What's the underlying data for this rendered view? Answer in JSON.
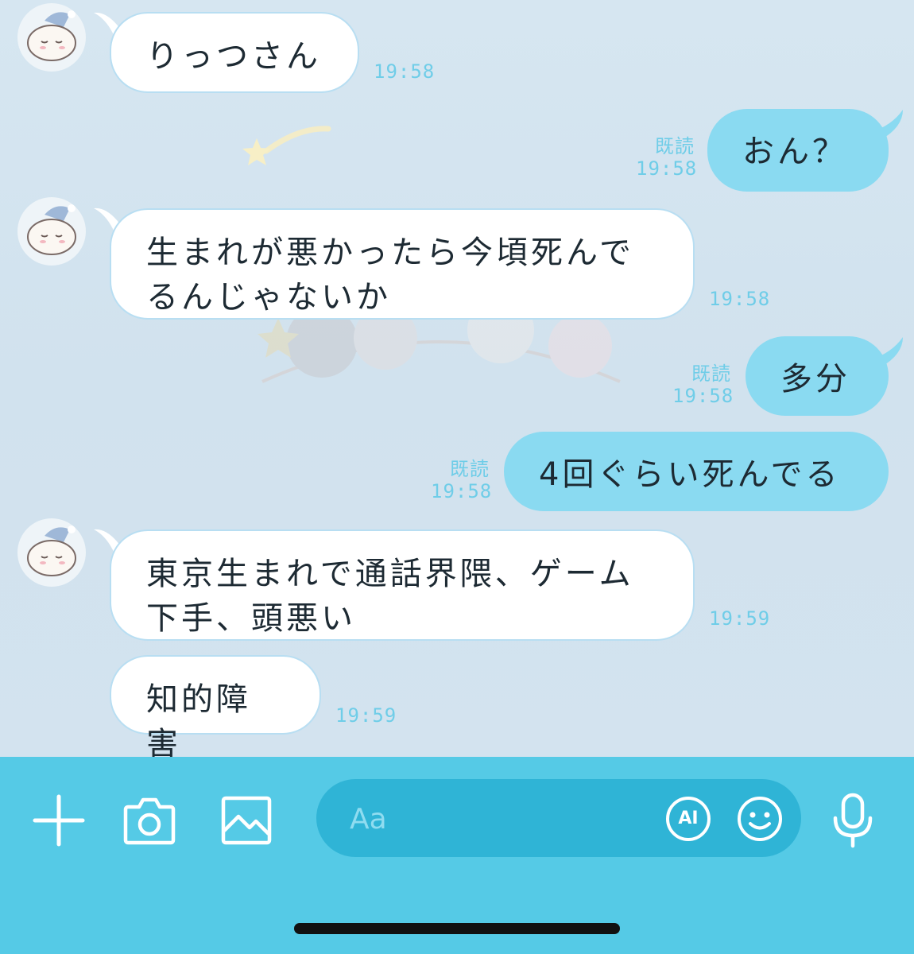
{
  "messages": [
    {
      "text": "りっつさん",
      "time": "19:58"
    },
    {
      "text": "おん？",
      "read": "既読",
      "time": "19:58"
    },
    {
      "text": "生まれが悪かったら今頃死んで\nるんじゃないか",
      "time": "19:58"
    },
    {
      "text": "多分",
      "read": "既読",
      "time": "19:58"
    },
    {
      "text": "4回ぐらい死んでる",
      "read": "既読",
      "time": "19:58"
    },
    {
      "text": "東京生まれで通話界隈、ゲーム\n下手、頭悪い",
      "time": "19:59"
    },
    {
      "text": "知的障害",
      "time": "19:59"
    }
  ],
  "input": {
    "placeholder": "Aa",
    "ai_label": "AI",
    "icons": [
      "plus-icon",
      "camera-icon",
      "image-icon",
      "ai-icon",
      "emoji-icon",
      "microphone-icon"
    ]
  },
  "colors": {
    "input_bar": "#55cae6",
    "input_field": "#2fb4d6",
    "outgoing_bubble": "#8adaf1",
    "incoming_bubble": "#ffffff",
    "timestamp": "#6fcde8"
  }
}
